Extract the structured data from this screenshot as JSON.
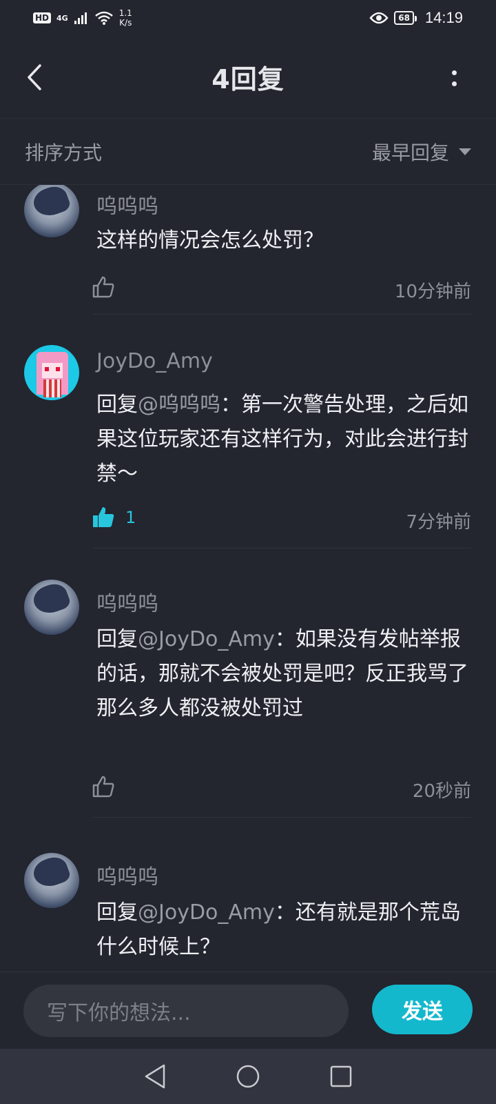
{
  "status_bar": {
    "hd": "HD",
    "network": "4G",
    "speed_value": "1.1",
    "speed_unit": "K/s",
    "battery": "68",
    "time": "14:19"
  },
  "header": {
    "title": "4回复"
  },
  "sort": {
    "label": "排序方式",
    "selected": "最早回复"
  },
  "replies": [
    {
      "username": "呜呜呜",
      "prefix": "",
      "mention": "",
      "text": "这样的情况会怎么处罚？",
      "likes": "",
      "liked": false,
      "time": "10分钟前"
    },
    {
      "username": "JoyDo_Amy",
      "prefix": "回复",
      "mention": "@呜呜呜",
      "text": "：第一次警告处理，之后如果这位玩家还有这样行为，对此会进行封禁～",
      "likes": "1",
      "liked": true,
      "time": "7分钟前"
    },
    {
      "username": "呜呜呜",
      "prefix": "回复",
      "mention": "@JoyDo_Amy",
      "text": "：如果没有发帖举报的话，那就不会被处罚是吧？反正我骂了那么多人都没被处罚过",
      "likes": "",
      "liked": false,
      "time": "20秒前"
    },
    {
      "username": "呜呜呜",
      "prefix": "回复",
      "mention": "@JoyDo_Amy",
      "text": "：还有就是那个荒岛什么时候上？",
      "likes": "",
      "liked": false,
      "time": ""
    }
  ],
  "composer": {
    "placeholder": "写下你的想法...",
    "send_label": "发送"
  },
  "colors": {
    "background": "#23252f",
    "accent": "#14b8cc",
    "liked": "#27c6dc",
    "muted_text": "#8e9097"
  }
}
